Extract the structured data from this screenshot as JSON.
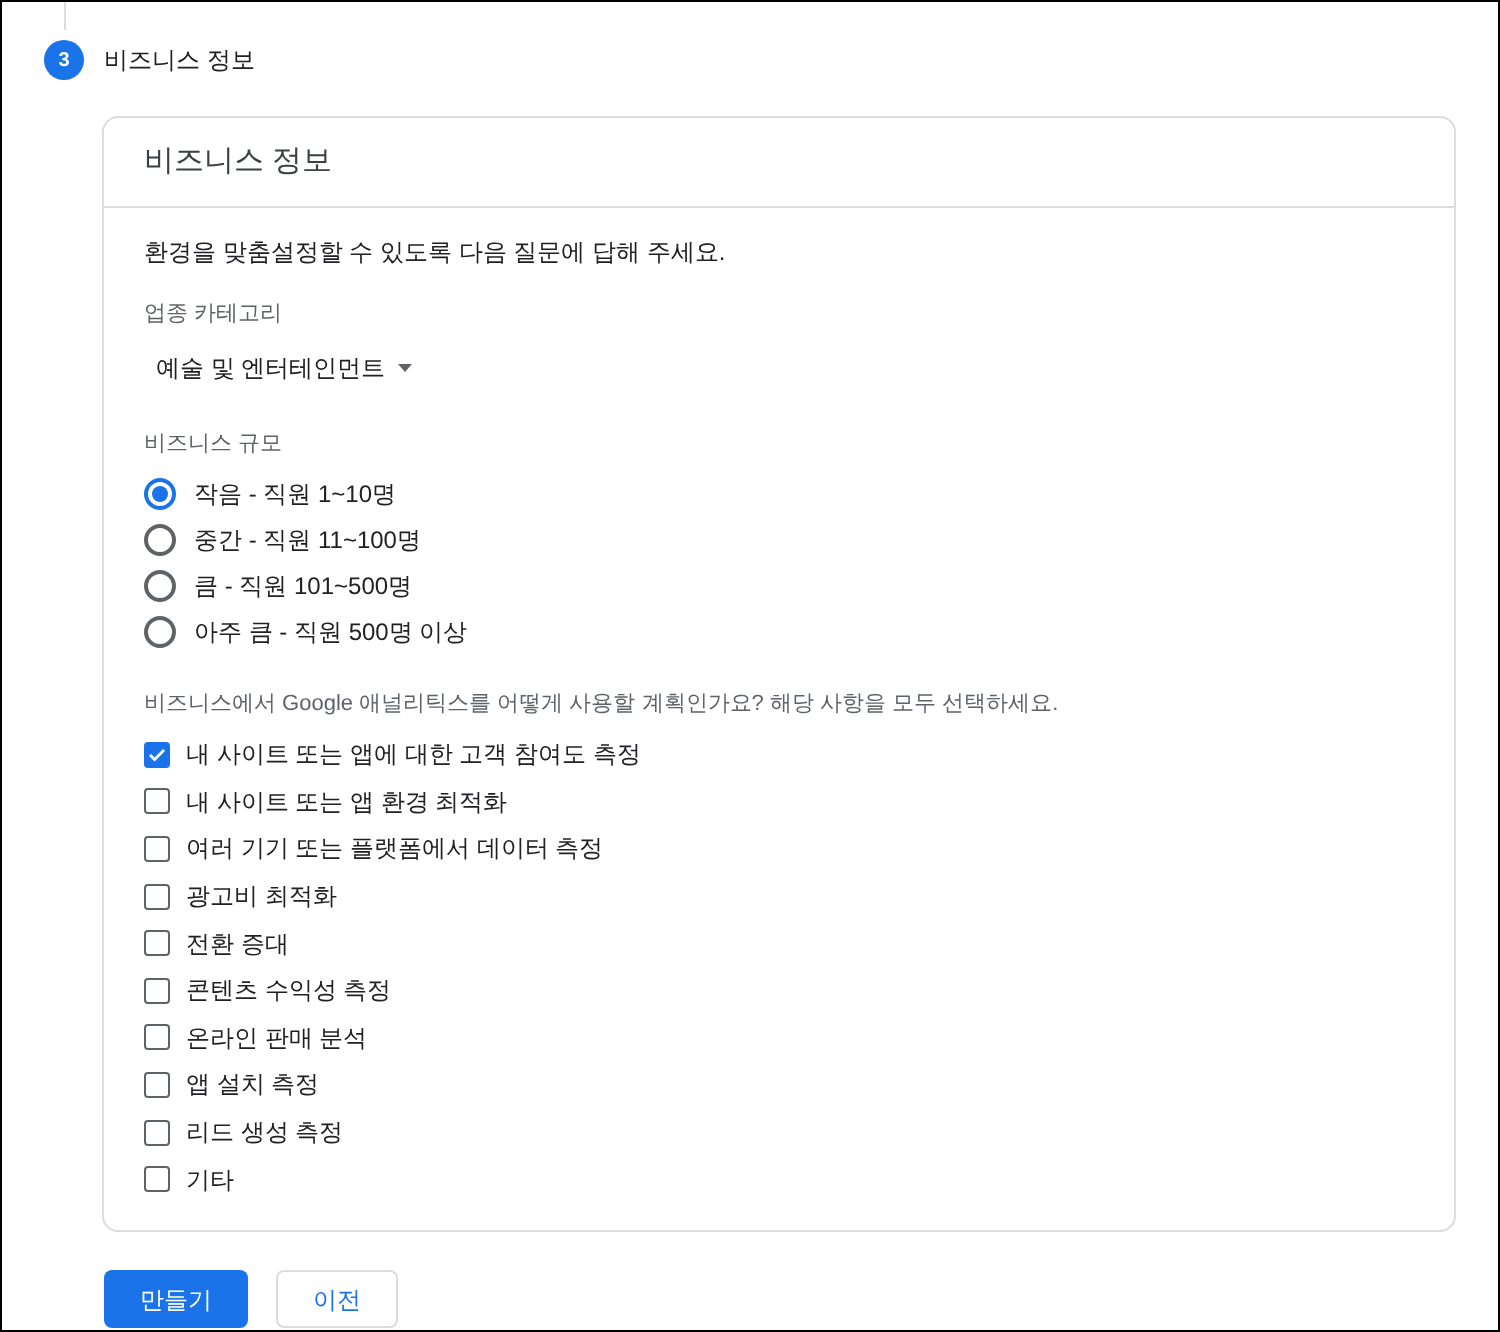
{
  "step": {
    "number": "3",
    "title": "비즈니스 정보"
  },
  "card": {
    "title": "비즈니스 정보",
    "intro": "환경을 맞춤설정할 수 있도록 다음 질문에 답해 주세요.",
    "category": {
      "label": "업종 카테고리",
      "value": "예술 및 엔터테인먼트"
    },
    "size": {
      "label": "비즈니스 규모",
      "options": [
        {
          "label": "작음 - 직원 1~10명",
          "selected": true
        },
        {
          "label": "중간 - 직원 11~100명",
          "selected": false
        },
        {
          "label": "큼 - 직원 101~500명",
          "selected": false
        },
        {
          "label": "아주 큼 - 직원 500명 이상",
          "selected": false
        }
      ]
    },
    "usage": {
      "label": "비즈니스에서 Google 애널리틱스를 어떻게 사용할 계획인가요? 해당 사항을 모두 선택하세요.",
      "options": [
        {
          "label": "내 사이트 또는 앱에 대한 고객 참여도 측정",
          "checked": true
        },
        {
          "label": "내 사이트 또는 앱 환경 최적화",
          "checked": false
        },
        {
          "label": "여러 기기 또는 플랫폼에서 데이터 측정",
          "checked": false
        },
        {
          "label": "광고비 최적화",
          "checked": false
        },
        {
          "label": "전환 증대",
          "checked": false
        },
        {
          "label": "콘텐츠 수익성 측정",
          "checked": false
        },
        {
          "label": "온라인 판매 분석",
          "checked": false
        },
        {
          "label": "앱 설치 측정",
          "checked": false
        },
        {
          "label": "리드 생성 측정",
          "checked": false
        },
        {
          "label": "기타",
          "checked": false
        }
      ]
    }
  },
  "buttons": {
    "primary": "만들기",
    "secondary": "이전"
  }
}
